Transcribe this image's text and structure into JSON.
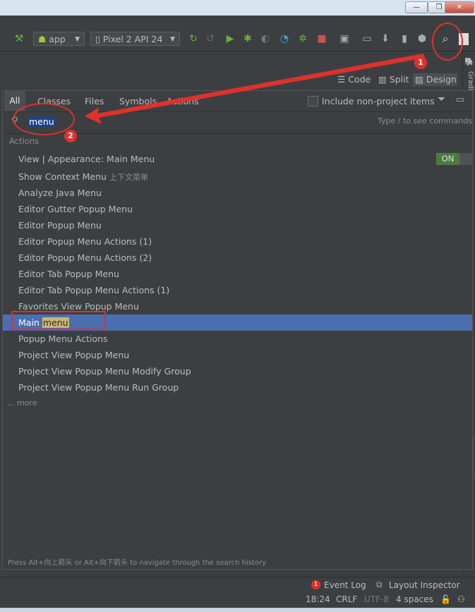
{
  "window": {
    "minimize_glyph": "—",
    "restore_glyph": "❐",
    "close_glyph": "✕"
  },
  "toolbar": {
    "run_config": "app",
    "device": "Pixel 2 API 24"
  },
  "editor_views": {
    "code": "Code",
    "split": "Split",
    "design": "Design"
  },
  "right_strip": {
    "label": "Gradl"
  },
  "search_popup": {
    "tabs": [
      "All",
      "Classes",
      "Files",
      "Symbols",
      "Actions"
    ],
    "include_non_project": "Include non-project items",
    "query": "menu",
    "type_hint": "Type / to see commands",
    "section_header": "Actions",
    "results": [
      {
        "label": "View | Appearance: Main Menu",
        "toggle": "ON"
      },
      {
        "label": "Show Context Menu",
        "suffix": "上下文菜单"
      },
      {
        "label": "Analyze Java Menu"
      },
      {
        "label": "Editor Gutter Popup Menu"
      },
      {
        "label": "Editor Popup Menu"
      },
      {
        "label": "Editor Popup Menu Actions (1)"
      },
      {
        "label": "Editor Popup Menu Actions (2)"
      },
      {
        "label": "Editor Tab Popup Menu"
      },
      {
        "label": "Editor Tab Popup Menu Actions (1)"
      },
      {
        "label": "Favorites View Popup Menu"
      },
      {
        "label_prefix": "Main ",
        "label_match": "menu",
        "selected": true
      },
      {
        "label": "Popup Menu Actions"
      },
      {
        "label": "Project View Popup Menu"
      },
      {
        "label": "Project View Popup Menu Modify Group"
      },
      {
        "label": "Project View Popup Menu Run Group"
      }
    ],
    "more": "... more",
    "footer_hint": "Press Alt+向上箭头 or Alt+向下箭头 to navigate through the search history"
  },
  "status": {
    "event_log_count": "1",
    "event_log": "Event Log",
    "layout_inspector": "Layout Inspector",
    "position": "18:24",
    "line_sep": "CRLF",
    "encoding": "UTF-8",
    "indent": "4 spaces"
  },
  "annotations": {
    "badge1": "1",
    "badge2": "2"
  },
  "colors": {
    "selection": "#4b6eaf",
    "match_highlight": "#c9b672",
    "annotation": "#e0302c",
    "toggle_on": "#4a7c3f"
  }
}
